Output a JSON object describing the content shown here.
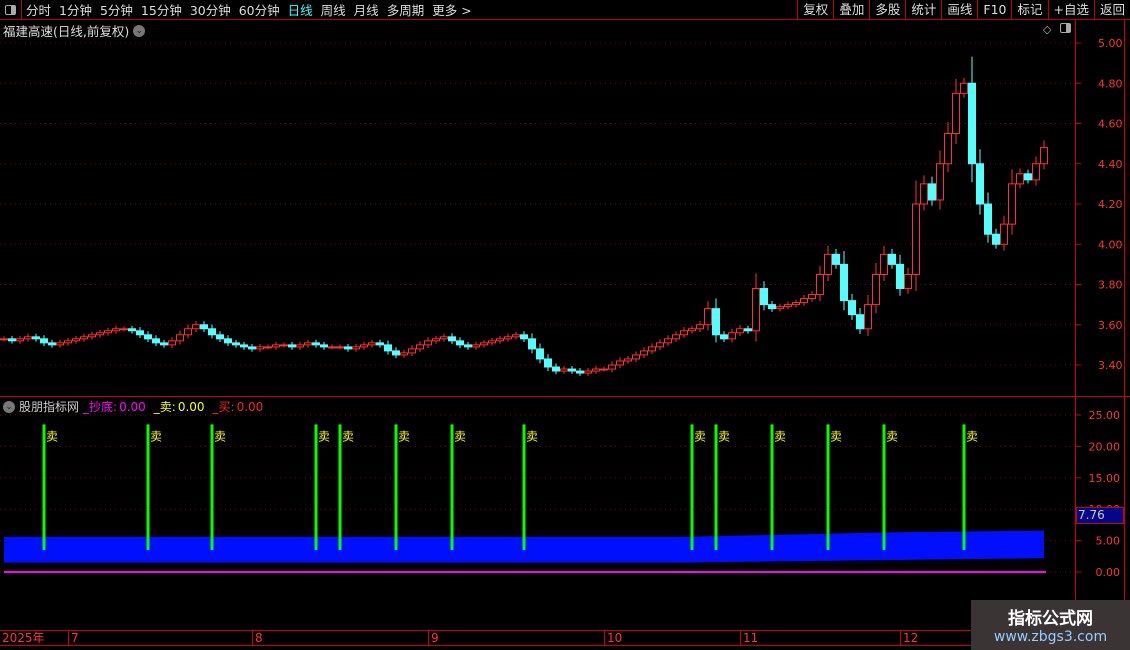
{
  "toolbar": {
    "items": [
      "分时",
      "1分钟",
      "5分钟",
      "15分钟",
      "30分钟",
      "60分钟",
      "日线",
      "周线",
      "月线",
      "多周期",
      "更多 >"
    ],
    "active": "日线",
    "right_buttons": [
      "复权",
      "叠加",
      "多股",
      "统计",
      "画线",
      "F10",
      "标记",
      "+自选",
      "返回"
    ]
  },
  "title": "福建高速(日线,前复权)",
  "indicator": {
    "name": "股朋指标网",
    "fields": [
      {
        "label": "_抄底:",
        "value": "0.00",
        "color": "#ff00ff"
      },
      {
        "label": "_卖:",
        "value": "0.00",
        "color": "#ffff00"
      },
      {
        "label": "_买:",
        "value": "0.00",
        "color": "#ff2020"
      }
    ],
    "current_value": "7.76",
    "sell_label": "卖"
  },
  "date_axis": [
    {
      "label": "2025年",
      "i": 0
    },
    {
      "label": "7",
      "i": 8
    },
    {
      "label": "8",
      "i": 31
    },
    {
      "label": "9",
      "i": 53
    },
    {
      "label": "10",
      "i": 75
    },
    {
      "label": "11",
      "i": 92
    },
    {
      "label": "12",
      "i": 112
    }
  ],
  "watermark": {
    "line1": "指标公式网",
    "line2": "www.zbgs3.com"
  },
  "colors": {
    "up": "#ff3030",
    "down": "#54ffff",
    "axis": "#ff3333",
    "band": "#0010ff",
    "sell_line": "#00ff00",
    "sell_text": "#ffff00",
    "zero_line": "#ff00ff"
  },
  "chart_data": [
    {
      "type": "candlestick",
      "ylim": [
        3.3,
        5.05
      ],
      "yticks": [
        "3.40",
        "3.60",
        "3.80",
        "4.00",
        "4.20",
        "4.40",
        "4.60",
        "4.80",
        "5.00"
      ],
      "close": [
        3.53,
        3.52,
        3.53,
        3.54,
        3.53,
        3.51,
        3.5,
        3.51,
        3.52,
        3.53,
        3.54,
        3.55,
        3.56,
        3.57,
        3.58,
        3.58,
        3.57,
        3.55,
        3.53,
        3.51,
        3.5,
        3.52,
        3.55,
        3.58,
        3.6,
        3.58,
        3.55,
        3.53,
        3.51,
        3.5,
        3.49,
        3.48,
        3.49,
        3.49,
        3.5,
        3.5,
        3.49,
        3.5,
        3.51,
        3.5,
        3.49,
        3.49,
        3.49,
        3.48,
        3.49,
        3.5,
        3.51,
        3.5,
        3.47,
        3.45,
        3.46,
        3.48,
        3.5,
        3.52,
        3.53,
        3.54,
        3.52,
        3.5,
        3.49,
        3.5,
        3.51,
        3.52,
        3.53,
        3.54,
        3.55,
        3.53,
        3.48,
        3.43,
        3.39,
        3.37,
        3.38,
        3.37,
        3.36,
        3.37,
        3.38,
        3.38,
        3.4,
        3.42,
        3.43,
        3.45,
        3.47,
        3.49,
        3.51,
        3.53,
        3.55,
        3.57,
        3.58,
        3.6,
        3.68,
        3.55,
        3.53,
        3.56,
        3.58,
        3.57,
        3.78,
        3.7,
        3.68,
        3.69,
        3.7,
        3.71,
        3.73,
        3.75,
        3.85,
        3.95,
        3.9,
        3.72,
        3.65,
        3.58,
        3.7,
        3.85,
        3.95,
        3.9,
        3.78,
        3.85,
        4.2,
        4.3,
        4.22,
        4.4,
        4.55,
        4.75,
        4.8,
        4.4,
        4.2,
        4.05,
        4.0,
        4.1,
        4.3,
        4.35,
        4.32,
        4.4,
        4.48
      ]
    },
    {
      "type": "indicator",
      "ylim": [
        -4,
        27
      ],
      "yticks": [
        "0.00",
        "5.00",
        "10.00",
        "15.00",
        "20.00",
        "25.00"
      ],
      "sell_signals": [
        5,
        18,
        26,
        39,
        42,
        49,
        56,
        65,
        86,
        89,
        96,
        103,
        110,
        120
      ],
      "sell_top": 23.5,
      "sell_bottom": 3.5,
      "band_upper": [
        [
          0,
          5.6
        ],
        [
          85,
          5.6
        ],
        [
          110,
          6.3
        ],
        [
          130,
          6.6
        ]
      ],
      "band_lower": [
        [
          0,
          1.5
        ],
        [
          85,
          1.5
        ],
        [
          130,
          2.2
        ]
      ],
      "zero_line": 0
    }
  ]
}
